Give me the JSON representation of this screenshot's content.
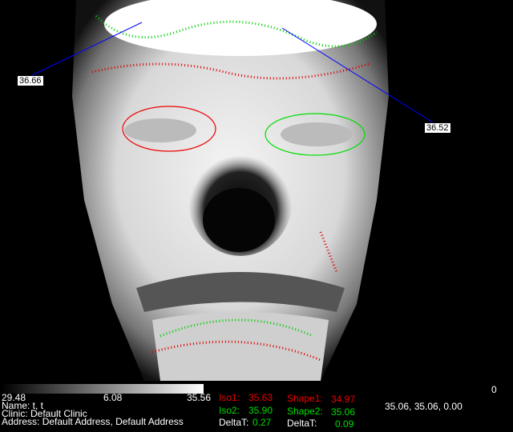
{
  "markers": [
    {
      "label": "36.66"
    },
    {
      "label": "36.52"
    }
  ],
  "scale": {
    "min": "29.48",
    "mid": "6.08",
    "max": "35.56"
  },
  "patient": {
    "name": "Name: t, t",
    "clinic": "Clinic: Default Clinic",
    "address": "Address: Default Address, Default Address"
  },
  "iso": {
    "iso1_label": "Iso1:",
    "iso1_value": "35.63",
    "iso2_label": "Iso2:",
    "iso2_value": "35.90",
    "delta_label": "DeltaT:",
    "delta_value": "0.27"
  },
  "shape": {
    "shape1_label": "Shape1:",
    "shape1_value": "34.97",
    "shape2_label": "Shape2:",
    "shape2_value": "35.06",
    "delta_label": "DeltaT:",
    "delta_value": "0.09"
  },
  "cursor_readout": "35.06, 35.06, 0.00",
  "counter": "0",
  "colors": {
    "iso1": "#e00000",
    "iso2": "#00d000"
  }
}
